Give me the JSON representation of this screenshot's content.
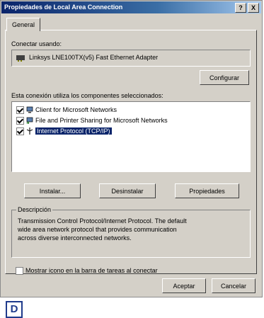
{
  "window": {
    "title": "Propiedades de Local Area Connection",
    "help_btn": "?",
    "close_btn": "X"
  },
  "tabs": [
    {
      "label": "General"
    }
  ],
  "connect_using": {
    "label": "Conectar usando:",
    "adapter": "Linksys LNE100TX(v5) Fast Ethernet Adapter",
    "configure_button": "Configurar"
  },
  "components": {
    "label": "Esta conexión utiliza los componentes seleccionados:",
    "items": [
      {
        "label": "Client for Microsoft Networks",
        "checked": true,
        "icon": "network-client-icon"
      },
      {
        "label": "File and Printer Sharing for Microsoft Networks",
        "checked": true,
        "icon": "file-printer-sharing-icon"
      },
      {
        "label": "Internet Protocol (TCP/IP)",
        "checked": true,
        "icon": "protocol-icon",
        "selected": true
      }
    ]
  },
  "actions": {
    "install": "Instalar...",
    "uninstall": "Desinstalar",
    "properties": "Propiedades"
  },
  "description": {
    "label": "Descripción",
    "lines": [
      "Transmission Control Protocol/Internet Protocol. The default",
      "wide area network protocol that provides communication",
      "across diverse interconnected networks."
    ]
  },
  "taskbar_icon": {
    "label": "Mostrar icono en la barra de tareas al conectar",
    "checked": false
  },
  "footer": {
    "accept": "Aceptar",
    "cancel": "Cancelar"
  },
  "badge": {
    "label": "D"
  }
}
